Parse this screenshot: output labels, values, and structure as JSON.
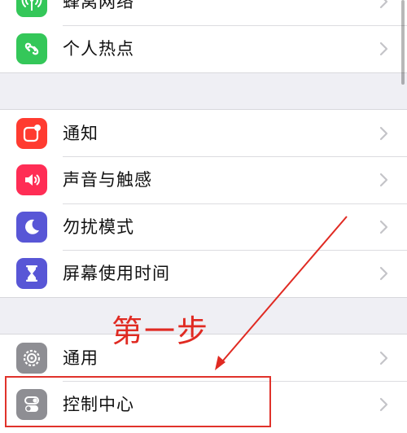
{
  "settings": {
    "rows": [
      {
        "label": "蜂窝网络",
        "icon": "antenna-icon",
        "color": "#34c759"
      },
      {
        "label": "个人热点",
        "icon": "hotspot-link-icon",
        "color": "#34c759"
      },
      {
        "label": "通知",
        "icon": "notification-icon",
        "color": "#ff3b30"
      },
      {
        "label": "声音与触感",
        "icon": "speaker-icon",
        "color": "#ff2d55"
      },
      {
        "label": "勿扰模式",
        "icon": "moon-icon",
        "color": "#5856d6"
      },
      {
        "label": "屏幕使用时间",
        "icon": "hourglass-icon",
        "color": "#5856d6"
      },
      {
        "label": "通用",
        "icon": "gear-icon",
        "color": "#8e8e93"
      },
      {
        "label": "控制中心",
        "icon": "toggle-icon",
        "color": "#8e8e93"
      }
    ]
  },
  "annotation": {
    "step_text": "第一步",
    "color": "#e02a22"
  }
}
